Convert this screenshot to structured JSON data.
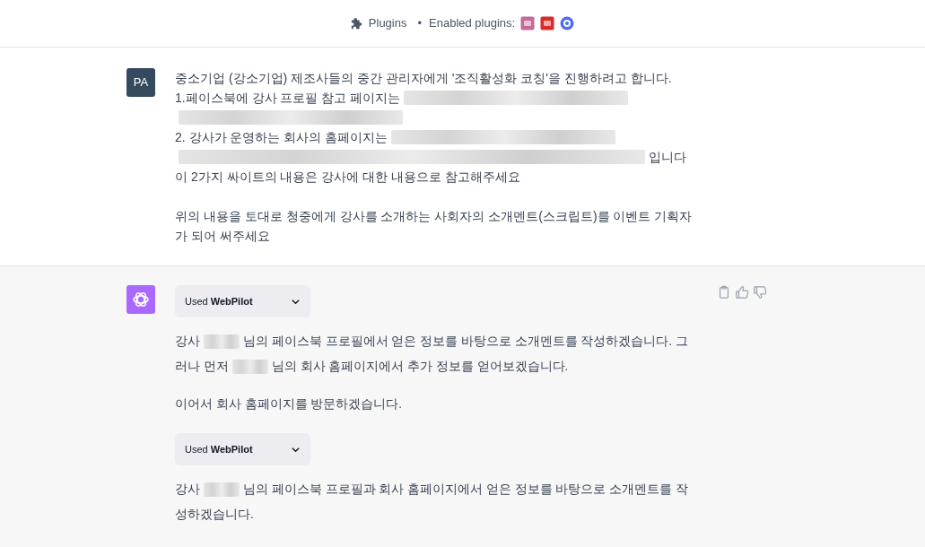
{
  "header": {
    "plugins_label": "Plugins",
    "separator": "•",
    "enabled_label": "Enabled plugins:",
    "plugin_icons": [
      {
        "color": "#c46a9a"
      },
      {
        "color": "#d92b2b"
      },
      {
        "color": "#4f6ef0"
      }
    ]
  },
  "user_message": {
    "avatar": "PA",
    "lines": [
      [
        {
          "kind": "text",
          "text": "중소기업 (강소기업) 제조사들의 중간 관리자에게 '조직활성화 코칭'을 진행하려고 합니다."
        }
      ],
      [
        {
          "kind": "text",
          "text": "1.페이스북에 강사 프로필 참고 페이지는"
        },
        {
          "kind": "redacted"
        }
      ],
      [
        {
          "kind": "redacted"
        }
      ],
      [
        {
          "kind": "text",
          "text": "2. 강사가 운영하는 회사의 홈페이지는"
        },
        {
          "kind": "redacted"
        }
      ],
      [
        {
          "kind": "redacted"
        },
        {
          "kind": "text",
          "text": "입니다"
        }
      ],
      [
        {
          "kind": "text",
          "text": "이 2가지 싸이트의 내용은 강사에 대한 내용으로 참고해주세요"
        }
      ],
      [
        {
          "kind": "blank"
        }
      ],
      [
        {
          "kind": "text",
          "text": "위의 내용을 토대로 청중에게 강사를 소개하는 사회자의 소개멘트(스크립트)를 이벤트 기획자"
        }
      ],
      [
        {
          "kind": "text",
          "text": "가 되어 써주세요"
        }
      ]
    ]
  },
  "assistant_message": {
    "blocks": [
      {
        "kind": "plugin",
        "prefix": "Used",
        "name": "WebPilot",
        "expanded": false
      },
      {
        "kind": "paragraph",
        "lines": [
          [
            {
              "kind": "text",
              "text": "강사"
            },
            {
              "kind": "redacted"
            },
            {
              "kind": "text",
              "text": "님의 페이스북 프로필에서 얻은 정보를 바탕으로 소개멘트를 작성하겠습니다. 그"
            }
          ],
          [
            {
              "kind": "text",
              "text": "러나 먼저"
            },
            {
              "kind": "redacted"
            },
            {
              "kind": "text",
              "text": "님의 회사 홈페이지에서 추가 정보를 얻어보겠습니다."
            }
          ]
        ]
      },
      {
        "kind": "paragraph",
        "lines": [
          [
            {
              "kind": "text",
              "text": "이어서 회사 홈페이지를 방문하겠습니다."
            }
          ]
        ]
      },
      {
        "kind": "plugin",
        "prefix": "Used",
        "name": "WebPilot",
        "expanded": false
      },
      {
        "kind": "paragraph",
        "lines": [
          [
            {
              "kind": "text",
              "text": "강사"
            },
            {
              "kind": "redacted"
            },
            {
              "kind": "text",
              "text": "님의 페이스북 프로필과 회사 홈페이지에서 얻은 정보를 바탕으로 소개멘트를 작"
            }
          ],
          [
            {
              "kind": "text",
              "text": "성하겠습니다."
            }
          ]
        ]
      }
    ]
  }
}
